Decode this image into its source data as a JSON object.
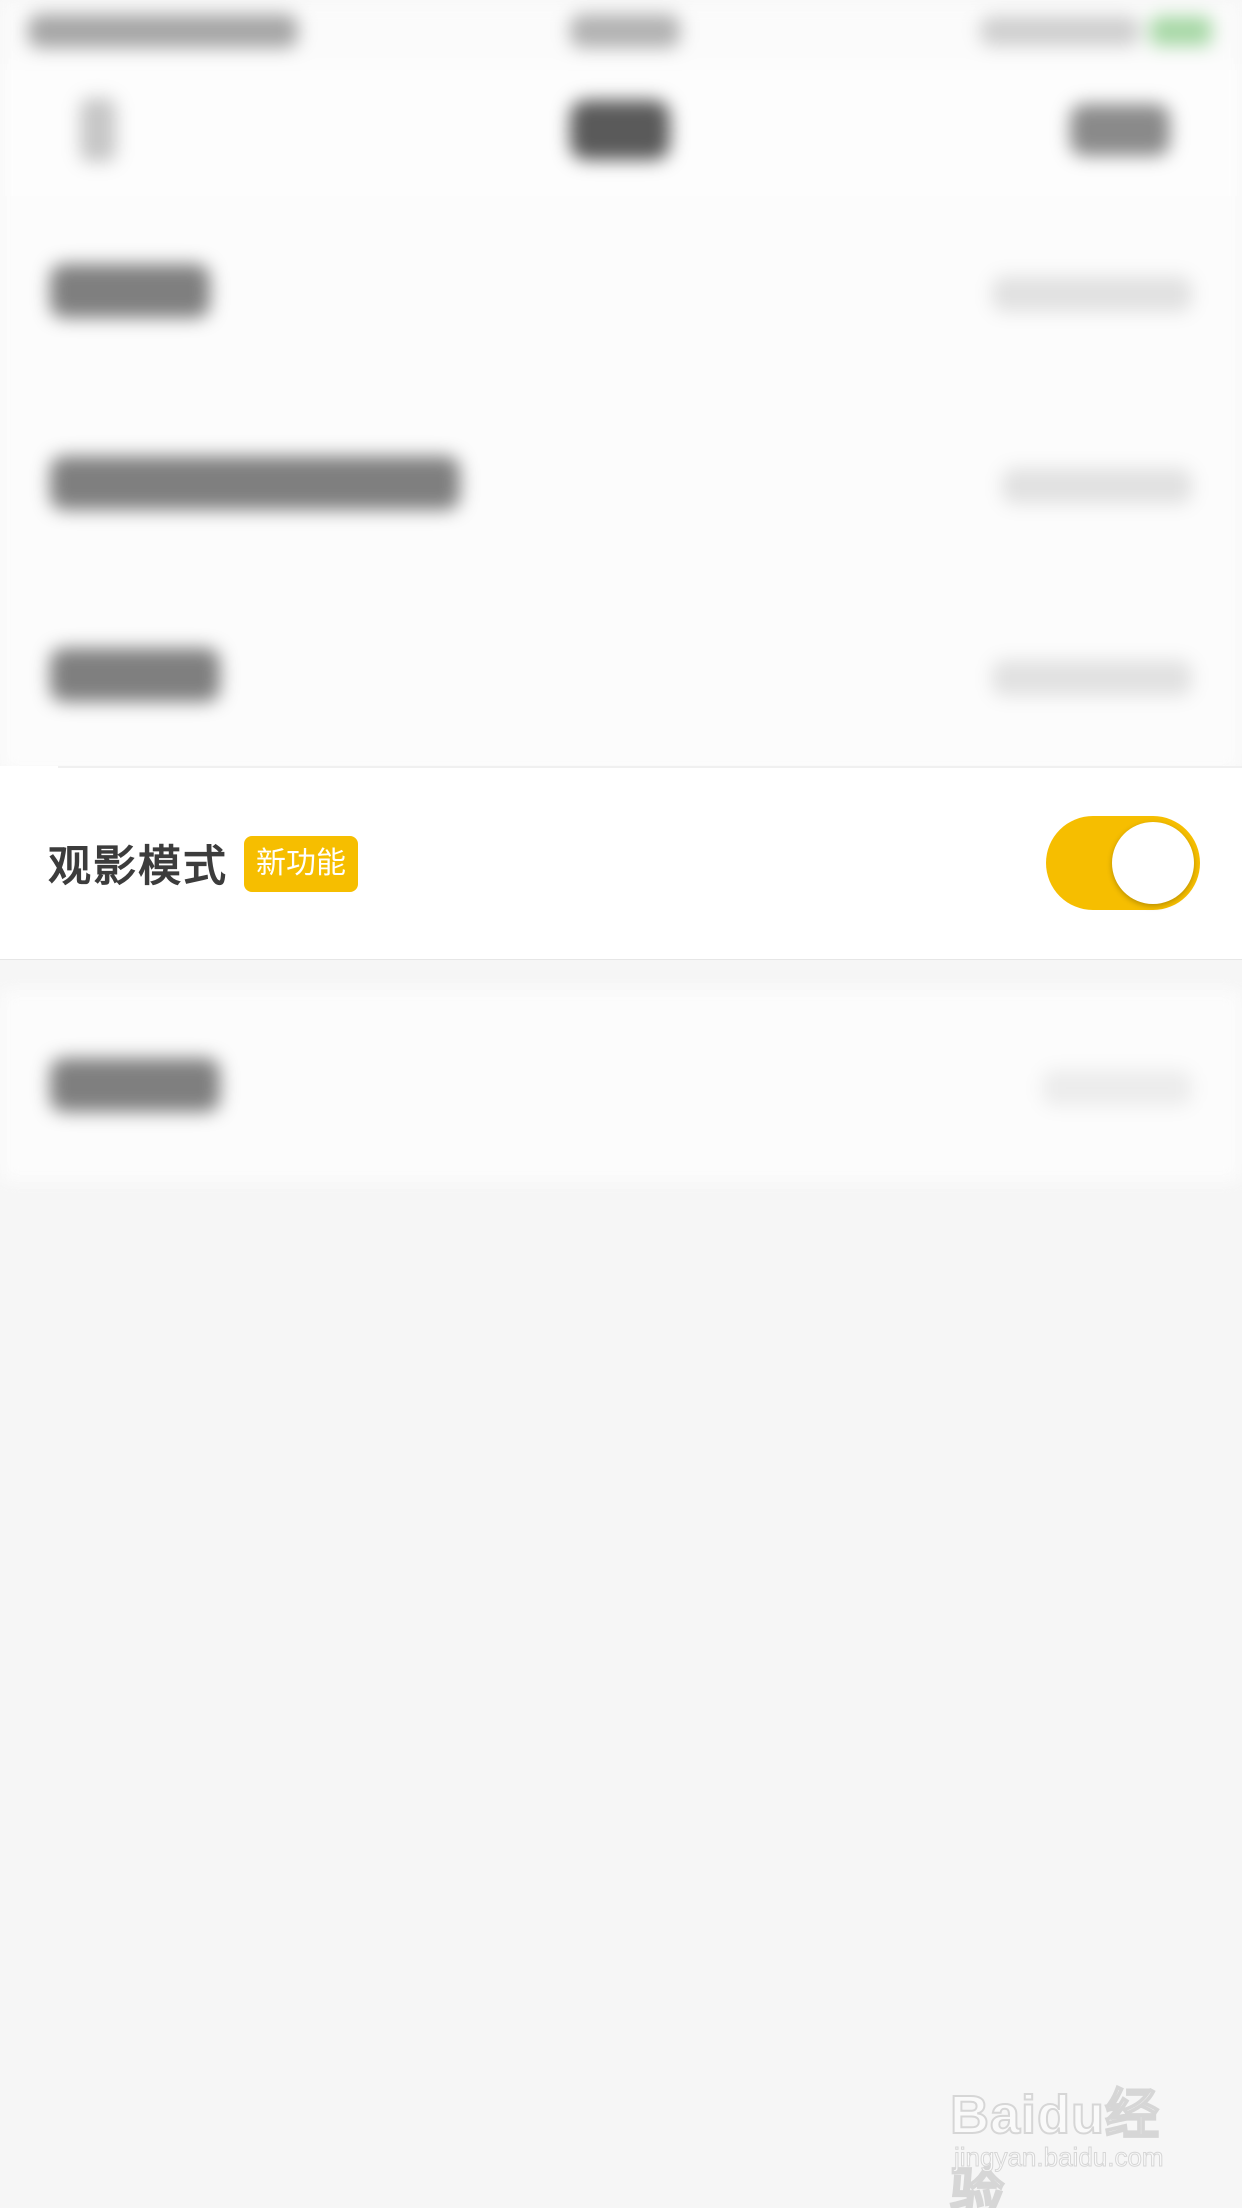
{
  "setting": {
    "label": "观影模式",
    "badge": "新功能",
    "toggle_on": true,
    "accent_color": "#f6be00"
  },
  "watermark": {
    "logo": "Baidu经验",
    "url": "jingyan.baidu.com"
  }
}
